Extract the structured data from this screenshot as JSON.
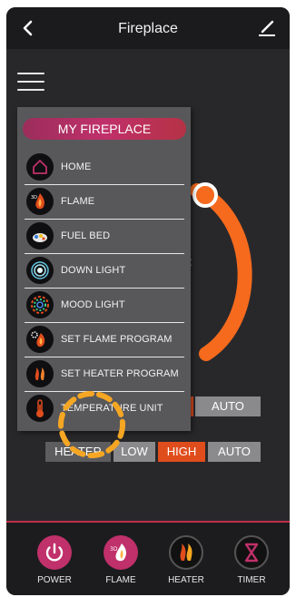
{
  "header": {
    "title": "Fireplace"
  },
  "drawer": {
    "title": "MY FIREPLACE",
    "items": [
      {
        "label": "HOME",
        "icon": "home-icon"
      },
      {
        "label": "FLAME",
        "icon": "flame-icon"
      },
      {
        "label": "FUEL BED",
        "icon": "fuel-bed-icon"
      },
      {
        "label": "DOWN LIGHT",
        "icon": "down-light-icon"
      },
      {
        "label": "MOOD LIGHT",
        "icon": "mood-light-icon"
      },
      {
        "label": "SET FLAME PROGRAM",
        "icon": "flame-program-icon"
      },
      {
        "label": "SET HEATER PROGRAM",
        "icon": "heater-program-icon"
      },
      {
        "label": "TEMPERATURE UNIT",
        "icon": "thermometer-icon"
      }
    ]
  },
  "controls": {
    "row1_auto": "AUTO",
    "heater_label": "HEATER",
    "low": "LOW",
    "high": "HIGH",
    "auto": "AUTO",
    "selected": "HIGH"
  },
  "bottom_nav": [
    {
      "label": "POWER",
      "icon": "power-icon"
    },
    {
      "label": "FLAME",
      "icon": "flame-icon"
    },
    {
      "label": "HEATER",
      "icon": "heater-icon"
    },
    {
      "label": "TIMER",
      "icon": "hourglass-icon"
    }
  ],
  "colors": {
    "accent": "#e04d1c",
    "drawer_header": "#c0306a",
    "background": "#28282b"
  }
}
